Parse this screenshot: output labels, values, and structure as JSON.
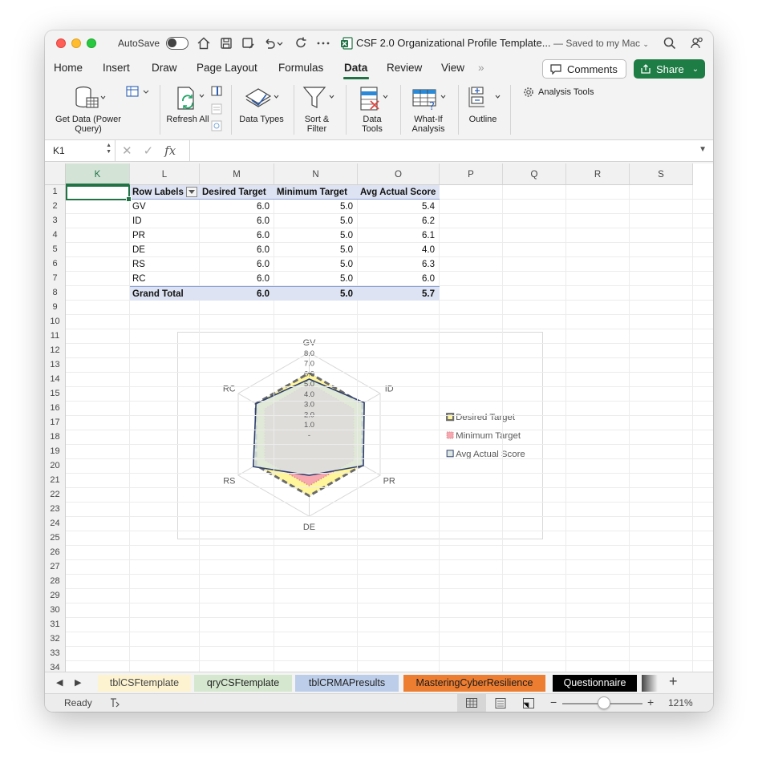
{
  "titlebar": {
    "autosave_label": "AutoSave",
    "doc_title": "CSF 2.0 Organizational Profile Template...",
    "saved_status": "— Saved to my Mac"
  },
  "menu": {
    "tabs": [
      "Home",
      "Insert",
      "Draw",
      "Page Layout",
      "Formulas",
      "Data",
      "Review",
      "View"
    ],
    "active_tab": "Data",
    "more": "»",
    "comments_label": "Comments",
    "share_label": "Share"
  },
  "ribbon": {
    "get_data": "Get Data (Power Query)",
    "refresh_all": "Refresh All",
    "data_types": "Data Types",
    "sort_filter": "Sort & Filter",
    "data_tools": "Data Tools",
    "what_if": "What-If Analysis",
    "outline": "Outline",
    "analysis_tools": "Analysis Tools"
  },
  "formula_bar": {
    "name_box": "K1",
    "fx": "fx",
    "content": ""
  },
  "columns": [
    "K",
    "L",
    "M",
    "N",
    "O",
    "P",
    "Q",
    "R",
    "S"
  ],
  "selected_column": "K",
  "rows": [
    "1",
    "2",
    "3",
    "4",
    "5",
    "6",
    "7",
    "8",
    "9",
    "10",
    "11",
    "12",
    "13",
    "14",
    "15",
    "16",
    "17",
    "18",
    "19",
    "20",
    "21",
    "22",
    "23",
    "24",
    "25",
    "26",
    "27",
    "28",
    "29",
    "30",
    "31",
    "32",
    "33",
    "34"
  ],
  "pivot": {
    "headers": [
      "Row Labels",
      "Desired Target",
      "Minimum Target",
      "Avg Actual Score"
    ],
    "rows": [
      [
        "GV",
        "6.0",
        "5.0",
        "5.4"
      ],
      [
        "ID",
        "6.0",
        "5.0",
        "6.2"
      ],
      [
        "PR",
        "6.0",
        "5.0",
        "6.1"
      ],
      [
        "DE",
        "6.0",
        "5.0",
        "4.0"
      ],
      [
        "RS",
        "6.0",
        "5.0",
        "6.3"
      ],
      [
        "RC",
        "6.0",
        "5.0",
        "6.0"
      ]
    ],
    "total": [
      "Grand Total",
      "6.0",
      "5.0",
      "5.7"
    ]
  },
  "chart_data": {
    "type": "radar",
    "categories": [
      "GV",
      "ID",
      "PR",
      "DE",
      "RS",
      "RC"
    ],
    "series": [
      {
        "name": "Desired Target",
        "values": [
          6.0,
          6.0,
          6.0,
          6.0,
          6.0,
          6.0
        ],
        "color": "#6b6b6b",
        "fill": "#fff59a"
      },
      {
        "name": "Minimum Target",
        "values": [
          5.0,
          5.0,
          5.0,
          5.0,
          5.0,
          5.0
        ],
        "color": "#d98a8a",
        "fill": "#f6a7b0"
      },
      {
        "name": "Avg Actual Score",
        "values": [
          5.4,
          6.2,
          6.1,
          4.0,
          6.3,
          6.0
        ],
        "color": "#2f3f6f",
        "fill": "#dbe6e2"
      }
    ],
    "tick_labels": [
      "-",
      "1.0",
      "2.0",
      "3.0",
      "4.0",
      "5.0",
      "6.0",
      "7.0",
      "8.0"
    ],
    "rmax": 8,
    "legend": "right"
  },
  "sheets": [
    {
      "name": "tblCSFtemplate",
      "bg": "#fdf3d0",
      "color": "#444"
    },
    {
      "name": "qryCSFtemplate",
      "bg": "#d5e8cf",
      "color": "#222"
    },
    {
      "name": "tblCRMAPresults",
      "bg": "#bccde9",
      "color": "#222"
    },
    {
      "name": "MasteringCyberResilience",
      "bg": "#ed7d31",
      "color": "#1a1a1a"
    },
    {
      "name": "Questionnaire",
      "bg": "#000000",
      "color": "#ffffff"
    }
  ],
  "add_sheet": "+",
  "status": {
    "ready": "Ready",
    "zoom": "121%"
  }
}
